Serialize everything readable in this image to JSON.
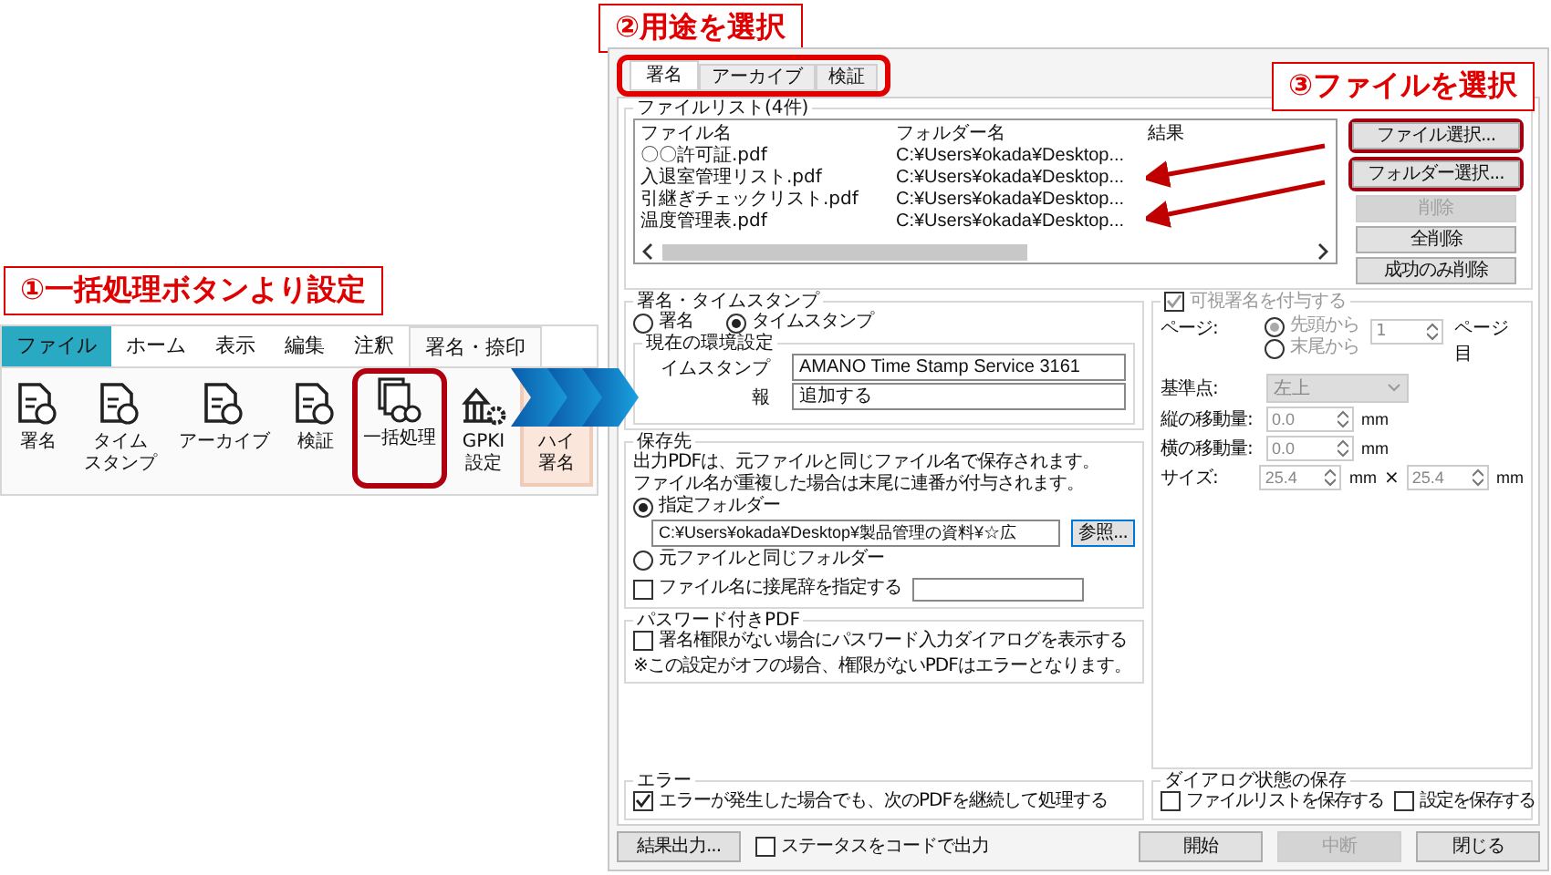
{
  "ribbon": {
    "callout": "①一括処理ボタンより設定",
    "tabs": [
      {
        "label": "ファイル",
        "kind": "file",
        "selected": false
      },
      {
        "label": "ホーム",
        "kind": "tab",
        "selected": false
      },
      {
        "label": "表示",
        "kind": "tab",
        "selected": false
      },
      {
        "label": "編集",
        "kind": "tab",
        "selected": false
      },
      {
        "label": "注釈",
        "kind": "tab",
        "selected": false
      },
      {
        "label": "署名・捺印",
        "kind": "tab",
        "selected": true
      }
    ],
    "buttons": [
      {
        "lines": [
          "署名"
        ],
        "circled": false,
        "accent": false
      },
      {
        "lines": [
          "タイム",
          "スタンプ"
        ],
        "circled": false,
        "accent": false
      },
      {
        "lines": [
          "アーカイブ"
        ],
        "circled": false,
        "accent": false
      },
      {
        "lines": [
          "検証"
        ],
        "circled": false,
        "accent": false
      },
      {
        "lines": [
          "一括処理"
        ],
        "circled": true,
        "accent": false
      },
      {
        "lines": [
          "GPKI",
          "設定"
        ],
        "circled": false,
        "accent": false
      },
      {
        "lines": [
          "ハイ",
          "署名"
        ],
        "circled": false,
        "accent": true
      }
    ]
  },
  "dialog": {
    "tabs_callout": "②用途を選択",
    "tabs_circled": true,
    "tabs": [
      {
        "label": "署名",
        "selected": true
      },
      {
        "label": "アーカイブ",
        "selected": false
      },
      {
        "label": "検証",
        "selected": false
      }
    ],
    "files_callout": "③ファイルを選択",
    "file_list": {
      "legend": "ファイルリスト(4件)",
      "columns": [
        "ファイル名",
        "フォルダー名",
        "結果"
      ],
      "rows": [
        {
          "name": "〇〇許可証.pdf",
          "folder": "C:¥Users¥okada¥Desktop..."
        },
        {
          "name": "入退室管理リスト.pdf",
          "folder": "C:¥Users¥okada¥Desktop..."
        },
        {
          "name": "引継ぎチェックリスト.pdf",
          "folder": "C:¥Users¥okada¥Desktop..."
        },
        {
          "name": "温度管理表.pdf",
          "folder": "C:¥Users¥okada¥Desktop..."
        }
      ],
      "buttons": [
        {
          "label": "ファイル選択...",
          "disabled": false,
          "circled": true
        },
        {
          "label": "フォルダー選択...",
          "disabled": false,
          "circled": true
        },
        {
          "label": "削除",
          "disabled": true,
          "circled": false
        },
        {
          "label": "全削除",
          "disabled": false,
          "circled": false
        },
        {
          "label": "成功のみ削除",
          "disabled": false,
          "circled": false
        }
      ]
    },
    "stamp": {
      "legend": "署名・タイムスタンプ",
      "options": [
        {
          "label": "署名",
          "selected": false
        },
        {
          "label": "タイムスタンプ",
          "selected": true
        }
      ],
      "env": {
        "legend": "現在の環境設定",
        "rows": [
          {
            "label": "イムスタンプ",
            "value": "AMANO Time Stamp Service 3161"
          },
          {
            "label": "報",
            "value": "追加する"
          }
        ]
      }
    },
    "save": {
      "legend": "保存先",
      "notes": [
        "出力PDFは、元ファイルと同じファイル名で保存されます。",
        "ファイル名が重複した場合は末尾に連番が付与されます。"
      ],
      "options": [
        {
          "label": "指定フォルダー",
          "selected": true
        },
        {
          "label": "元ファイルと同じフォルダー",
          "selected": false
        }
      ],
      "path": "C:¥Users¥okada¥Desktop¥製品管理の資料¥☆広",
      "browse": "参照...",
      "suffix": {
        "label": "ファイル名に接尾辞を指定する",
        "checked": false
      }
    },
    "password": {
      "legend": "パスワード付きPDF",
      "check": {
        "label": "署名権限がない場合にパスワード入力ダイアログを表示する",
        "checked": false
      },
      "note": "※この設定がオフの場合、権限がないPDFはエラーとなります。"
    },
    "error": {
      "legend": "エラー",
      "check": {
        "label": "エラーが発生した場合でも、次のPDFを継続して処理する",
        "checked": true
      }
    },
    "visible": {
      "label": "可視署名を付与する",
      "checked": true,
      "disabled": true,
      "page_label": "ページ:",
      "page_options": [
        {
          "label": "先頭から",
          "selected": true
        },
        {
          "label": "末尾から",
          "selected": false
        }
      ],
      "page_value": "1",
      "page_suffix": "ページ目",
      "fields": [
        {
          "kind": "select",
          "label": "基準点:",
          "value": "左上"
        },
        {
          "kind": "spin",
          "label": "縦の移動量:",
          "value": "0.0",
          "unit": "mm"
        },
        {
          "kind": "spin",
          "label": "横の移動量:",
          "value": "0.0",
          "unit": "mm"
        },
        {
          "kind": "spin2",
          "label": "サイズ:",
          "value": "25.4",
          "unit": "mm",
          "sep": "×",
          "value2": "25.4",
          "unit2": "mm"
        }
      ]
    },
    "dialog_state": {
      "legend": "ダイアログ状態の保存",
      "checks": [
        {
          "label": "ファイルリストを保存する",
          "checked": false
        },
        {
          "label": "設定を保存する",
          "checked": false
        }
      ]
    },
    "footer": {
      "result_button": "結果出力...",
      "status_check": {
        "label": "ステータスをコードで出力",
        "checked": false
      },
      "buttons": [
        {
          "label": "開始",
          "disabled": false
        },
        {
          "label": "中断",
          "disabled": true
        },
        {
          "label": "閉じる",
          "disabled": false
        }
      ]
    }
  }
}
